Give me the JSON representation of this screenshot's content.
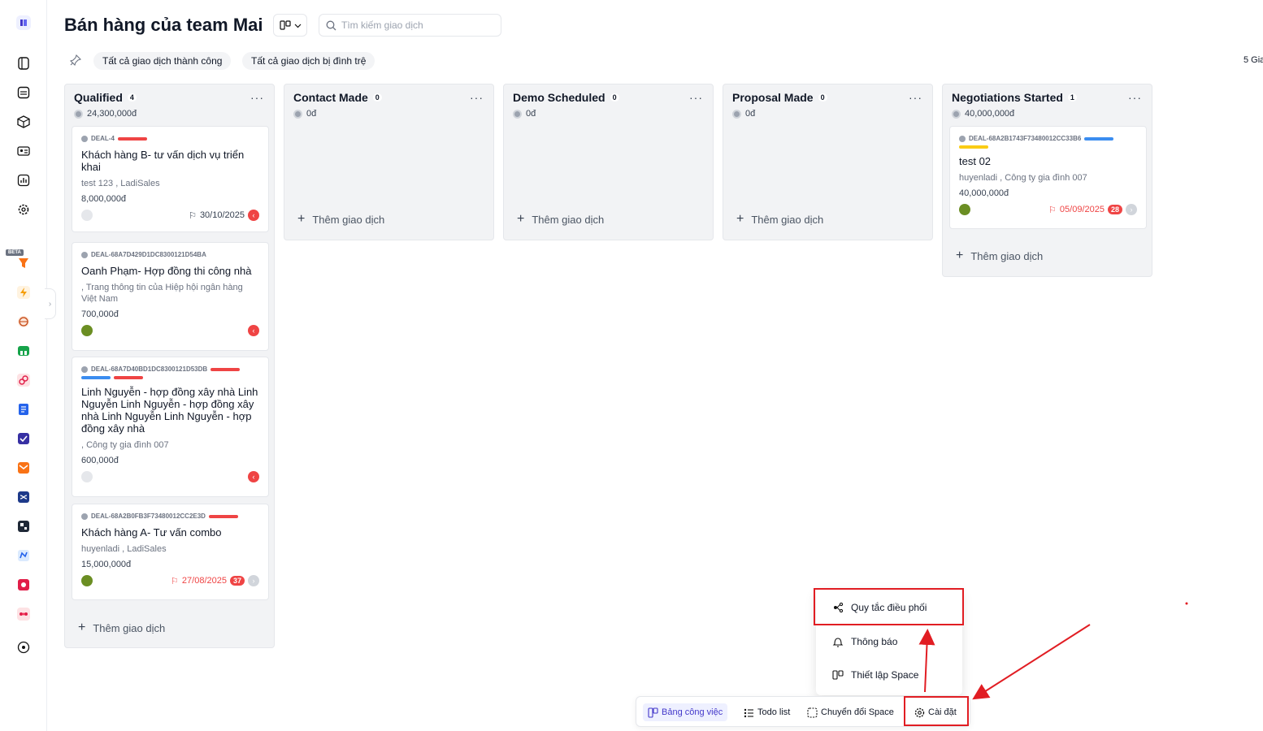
{
  "header": {
    "title": "Bán hàng của team Mai",
    "search_placeholder": "Tìm kiếm giao dịch",
    "deal_count": "5 Gia"
  },
  "filters": [
    "Tất cả giao dịch thành công",
    "Tất cả giao dịch bị đình trệ"
  ],
  "sidebar": {
    "beta_label": "BETA",
    "top_icons": [
      "workspace-icon",
      "book-icon",
      "inbox-icon",
      "cube-icon",
      "contact-card-icon",
      "analytics-icon",
      "settings-icon"
    ],
    "app_icons": [
      "funnel-app-icon",
      "flash-app-icon",
      "globe-app-icon",
      "store-app-icon",
      "link-app-icon",
      "document-app-icon",
      "form-app-icon",
      "mail-app-icon",
      "shuffle-app-icon",
      "grid-app-icon",
      "chat-app-icon",
      "media-app-icon",
      "team-app-icon",
      "add-app-icon"
    ]
  },
  "columns": [
    {
      "title": "Qualified",
      "count": "4",
      "sum": "24,300,000đ",
      "add_label": "Thêm giao dịch",
      "cards": [
        {
          "id": "DEAL-4",
          "title": "Khách hàng B- tư vấn dịch vụ triển khai",
          "sub": "test 123 , LadiSales",
          "amount": "8,000,000đ",
          "date": "30/10/2025"
        },
        {
          "id": "DEAL-68A7D429D1DC8300121D54BA",
          "title": "Oanh Phạm- Hợp đồng thi công nhà",
          "sub": ", Trang thông tin của Hiệp hội ngân hàng Việt Nam",
          "amount": "700,000đ",
          "date": ""
        },
        {
          "id": "DEAL-68A7D40BD1DC8300121D53DB",
          "title": "Linh Nguyễn - hợp đồng xây nhà Linh Nguyễn Linh Nguyễn - hợp đồng xây nhà Linh Nguyễn Linh Nguyễn - hợp đồng xây nhà",
          "sub": ", Công ty gia đình 007",
          "amount": "600,000đ",
          "date": ""
        },
        {
          "id": "DEAL-68A2B0FB3F73480012CC2E3D",
          "title": "Khách hàng A- Tư vấn combo",
          "sub": "huyenladi , LadiSales",
          "amount": "15,000,000đ",
          "date": "27/08/2025",
          "overdue": "37"
        }
      ]
    },
    {
      "title": "Contact Made",
      "count": "0",
      "sum": "0đ",
      "add_label": "Thêm giao dịch",
      "cards": []
    },
    {
      "title": "Demo Scheduled",
      "count": "0",
      "sum": "0đ",
      "add_label": "Thêm giao dịch",
      "cards": []
    },
    {
      "title": "Proposal Made",
      "count": "0",
      "sum": "0đ",
      "add_label": "Thêm giao dịch",
      "cards": []
    },
    {
      "title": "Negotiations Started",
      "count": "1",
      "sum": "40,000,000đ",
      "add_label": "Thêm giao dịch",
      "cards": [
        {
          "id": "DEAL-68A2B1743F73480012CC33B6",
          "title": "test 02",
          "sub": "huyenladi , Công ty gia đình 007",
          "amount": "40,000,000đ",
          "date": "05/09/2025",
          "overdue": "28"
        }
      ]
    }
  ],
  "settings_menu": {
    "items": [
      "Quy tắc điều phối",
      "Thông báo",
      "Thiết lập Space"
    ]
  },
  "bottom_bar": {
    "board": "Bảng công việc",
    "todo": "Todo list",
    "switch_space": "Chuyển đổi Space",
    "settings": "Cài đặt"
  },
  "colors": {
    "accent": "#4338ca",
    "annotation": "#e11d23",
    "tag_red": "#ef4444",
    "tag_blue": "#3b8df0",
    "tag_yellow": "#facc15"
  }
}
